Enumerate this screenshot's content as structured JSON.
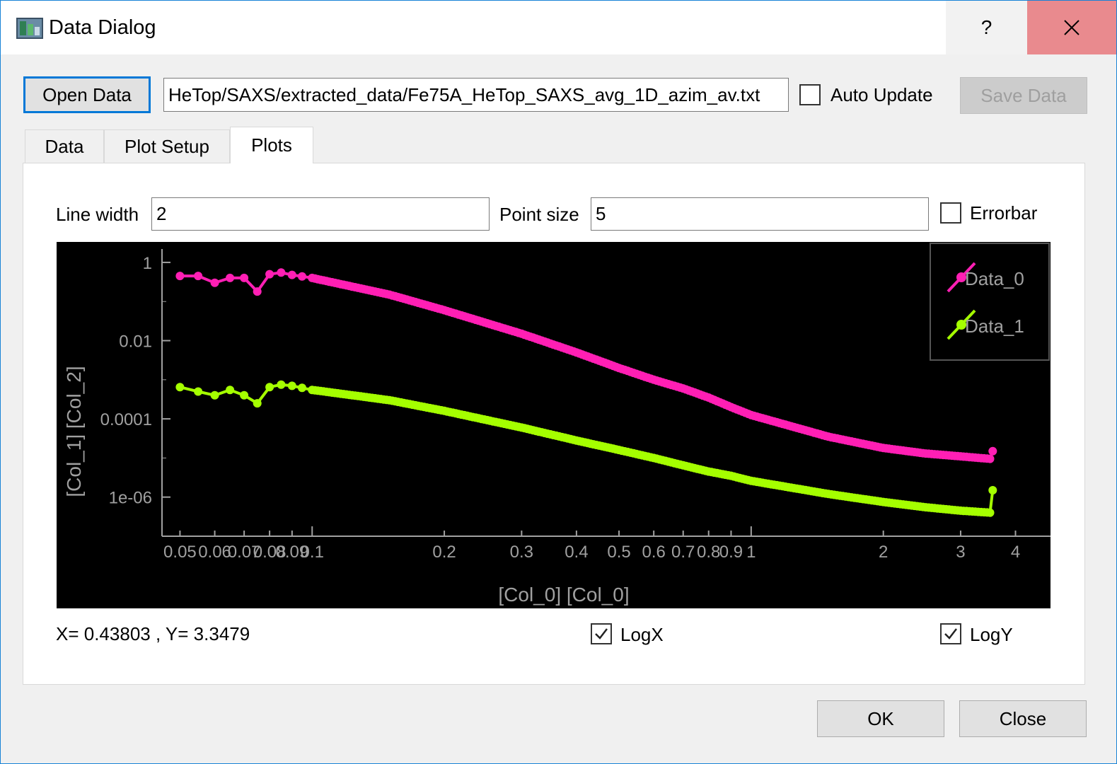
{
  "window": {
    "title": "Data Dialog",
    "help_label": "?",
    "icon": "app-icon"
  },
  "toolbar": {
    "open_label": "Open Data",
    "path_value": "HeTop/SAXS/extracted_data/Fe75A_HeTop_SAXS_avg_1D_azim_av.txt",
    "auto_update_label": "Auto Update",
    "auto_update_checked": false,
    "save_label": "Save Data"
  },
  "tabs": [
    {
      "label": "Data",
      "active": false
    },
    {
      "label": "Plot Setup",
      "active": false
    },
    {
      "label": "Plots",
      "active": true
    }
  ],
  "plots_tab": {
    "line_width_label": "Line width",
    "line_width_value": "2",
    "point_size_label": "Point size",
    "point_size_value": "5",
    "errorbar_label": "Errorbar",
    "errorbar_checked": false,
    "cursor_readout": "X= 0.43803 , Y= 3.3479",
    "logx_label": "LogX",
    "logx_checked": true,
    "logy_label": "LogY",
    "logy_checked": true
  },
  "buttons": {
    "ok_label": "OK",
    "close_label": "Close"
  },
  "chart_data": {
    "type": "scatter",
    "xlabel": "[Col_0] [Col_0]",
    "ylabel": "[Col_1] [Col_2]",
    "xscale": "log",
    "yscale": "log",
    "xlim": [
      0.0455,
      4.3
    ],
    "ylim": [
      1e-07,
      2.2
    ],
    "x_ticks": [
      "0.05",
      "0.06",
      "0.07",
      "0.08",
      "0.09",
      "0.1",
      "0.2",
      "0.3",
      "0.4",
      "0.5",
      "0.6",
      "0.7",
      "0.8",
      "0.9",
      "1",
      "2",
      "3",
      "4"
    ],
    "y_ticks": [
      "1",
      "0.01",
      "0.0001",
      "1e-06"
    ],
    "background": "#000000",
    "legend_position": "top-right",
    "series": [
      {
        "name": "Data_0",
        "color": "#ff1fb4",
        "x": [
          0.05,
          0.055,
          0.06,
          0.065,
          0.07,
          0.075,
          0.08,
          0.085,
          0.09,
          0.1,
          0.15,
          0.2,
          0.3,
          0.4,
          0.5,
          0.6,
          0.7,
          0.8,
          0.9,
          1.0,
          1.5,
          2.0,
          2.5,
          3.0,
          3.5,
          3.55
        ],
        "y": [
          0.45,
          0.45,
          0.3,
          0.4,
          0.4,
          0.18,
          0.5,
          0.55,
          0.48,
          0.4,
          0.15,
          0.06,
          0.015,
          0.005,
          0.002,
          0.001,
          0.0006,
          0.00035,
          0.0002,
          0.000125,
          3.5e-05,
          1.8e-05,
          1.3e-05,
          1.1e-05,
          9.5e-06,
          1.5e-05
        ]
      },
      {
        "name": "Data_1",
        "color": "#a5ff00",
        "x": [
          0.05,
          0.055,
          0.06,
          0.065,
          0.07,
          0.075,
          0.08,
          0.085,
          0.09,
          0.1,
          0.15,
          0.2,
          0.3,
          0.4,
          0.5,
          0.6,
          0.7,
          0.8,
          0.9,
          1.0,
          1.5,
          2.0,
          2.5,
          3.0,
          3.5,
          3.55
        ],
        "y": [
          0.00065,
          0.0005,
          0.0004,
          0.00055,
          0.0004,
          0.00025,
          0.00065,
          0.00075,
          0.0007,
          0.00055,
          0.0003,
          0.00016,
          6e-05,
          2.8e-05,
          1.6e-05,
          1e-05,
          6.5e-06,
          4.5e-06,
          3.5e-06,
          2.6e-06,
          1.2e-06,
          7.5e-07,
          5.5e-07,
          4.5e-07,
          4e-07,
          1.5e-06
        ]
      }
    ]
  }
}
